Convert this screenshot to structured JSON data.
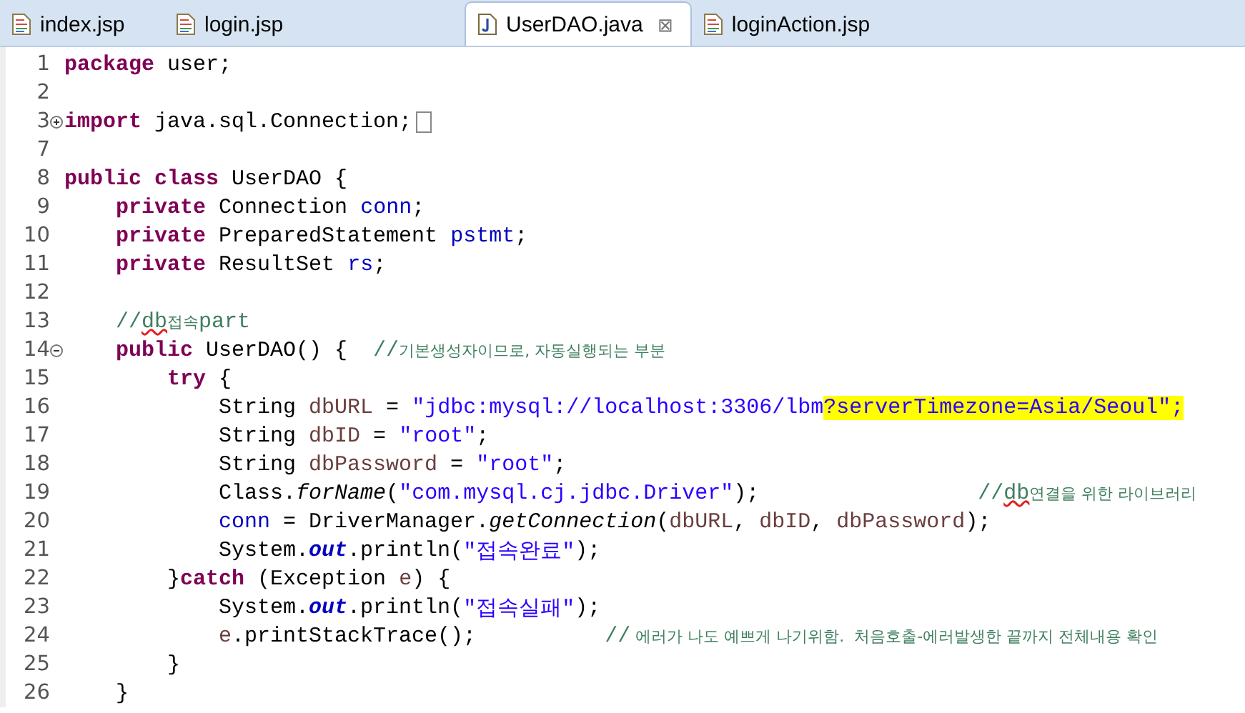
{
  "tabs": [
    {
      "label": "index.jsp",
      "kind": "jsp",
      "selected": false
    },
    {
      "label": "login.jsp",
      "kind": "jsp",
      "selected": false
    },
    {
      "label": "UserDAO.java",
      "kind": "java",
      "selected": true,
      "close": "⊠"
    },
    {
      "label": "loginAction.jsp",
      "kind": "jsp",
      "selected": false
    }
  ],
  "lines": [
    {
      "number": "1",
      "tokens": [
        {
          "kind": "keyword",
          "text": "package"
        },
        {
          "kind": "plain",
          "text": " user;"
        }
      ]
    },
    {
      "number": "2"
    },
    {
      "number": "3",
      "expanded": false,
      "tokens": [
        {
          "kind": "keyword",
          "text": "import"
        },
        {
          "kind": "plain",
          "text": " java.sql.Connection;"
        }
      ]
    },
    {
      "number": "7"
    },
    {
      "number": "8",
      "tokens": [
        {
          "kind": "keyword",
          "text": "public class"
        },
        {
          "kind": "plain",
          "text": " UserDAO {"
        }
      ]
    },
    {
      "number": "9",
      "tokens": [
        {
          "kind": "keyword",
          "text": "    private"
        },
        {
          "kind": "plain",
          "text": " Connection "
        },
        {
          "kind": "field",
          "text": "conn"
        },
        {
          "kind": "plain",
          "text": ";"
        }
      ]
    },
    {
      "number": "10",
      "tokens": [
        {
          "kind": "keyword",
          "text": "    private"
        },
        {
          "kind": "plain",
          "text": " PreparedStatement "
        },
        {
          "kind": "field",
          "text": "pstmt"
        },
        {
          "kind": "plain",
          "text": ";"
        }
      ]
    },
    {
      "number": "11",
      "tokens": [
        {
          "kind": "keyword",
          "text": "    private"
        },
        {
          "kind": "plain",
          "text": " ResultSet "
        },
        {
          "kind": "field",
          "text": "rs"
        },
        {
          "kind": "plain",
          "text": ";"
        }
      ]
    },
    {
      "number": "12"
    },
    {
      "number": "13",
      "tokens": [
        {
          "kind": "comment",
          "text": "    //"
        },
        {
          "kind": "misspelled",
          "text": "db"
        },
        {
          "kind": "note",
          "text": "접속"
        },
        {
          "kind": "comment",
          "text": "part"
        }
      ]
    },
    {
      "number": "14",
      "expanded": true,
      "tokens": [
        {
          "kind": "keyword",
          "text": "    public"
        },
        {
          "kind": "plain",
          "text": " UserDAO() {  "
        },
        {
          "kind": "comment",
          "text": "//"
        },
        {
          "kind": "note",
          "text": "기본생성자이므로, 자동실행되는 부분"
        }
      ]
    },
    {
      "number": "15",
      "tokens": [
        {
          "kind": "keyword",
          "text": "        try"
        },
        {
          "kind": "plain",
          "text": " {"
        }
      ]
    },
    {
      "number": "16",
      "tokens": [
        {
          "kind": "plain",
          "text": "            String "
        },
        {
          "kind": "local",
          "text": "dbURL"
        },
        {
          "kind": "plain",
          "text": " = "
        },
        {
          "kind": "string",
          "text": "\"jdbc:mysql://localhost:3306/lbm"
        },
        {
          "kind": "highlight",
          "text": "?serverTimezone=Asia/Seoul\";"
        }
      ]
    },
    {
      "number": "17",
      "tokens": [
        {
          "kind": "plain",
          "text": "            String "
        },
        {
          "kind": "local",
          "text": "dbID"
        },
        {
          "kind": "plain",
          "text": " = "
        },
        {
          "kind": "string",
          "text": "\"root\""
        },
        {
          "kind": "plain",
          "text": ";"
        }
      ]
    },
    {
      "number": "18",
      "tokens": [
        {
          "kind": "plain",
          "text": "            String "
        },
        {
          "kind": "local",
          "text": "dbPassword"
        },
        {
          "kind": "plain",
          "text": " = "
        },
        {
          "kind": "string",
          "text": "\"root\""
        },
        {
          "kind": "plain",
          "text": ";"
        }
      ]
    },
    {
      "number": "19",
      "tokens": [
        {
          "kind": "plain",
          "text": "            Class."
        },
        {
          "kind": "method",
          "text": "forName"
        },
        {
          "kind": "plain",
          "text": "("
        },
        {
          "kind": "string",
          "text": "\"com.mysql.cj.jdbc.Driver\""
        },
        {
          "kind": "plain",
          "text": ");                 "
        },
        {
          "kind": "comment",
          "text": "//"
        },
        {
          "kind": "misspelled",
          "text": "db"
        },
        {
          "kind": "note",
          "text": "연결을 위한 라이브러리"
        }
      ]
    },
    {
      "number": "20",
      "tokens": [
        {
          "kind": "field",
          "text": "            conn"
        },
        {
          "kind": "plain",
          "text": " = DriverManager."
        },
        {
          "kind": "method",
          "text": "getConnection"
        },
        {
          "kind": "plain",
          "text": "("
        },
        {
          "kind": "local",
          "text": "dbURL"
        },
        {
          "kind": "plain",
          "text": ", "
        },
        {
          "kind": "local",
          "text": "dbID"
        },
        {
          "kind": "plain",
          "text": ", "
        },
        {
          "kind": "local",
          "text": "dbPassword"
        },
        {
          "kind": "plain",
          "text": ");"
        }
      ]
    },
    {
      "number": "21",
      "tokens": [
        {
          "kind": "plain",
          "text": "            System."
        },
        {
          "kind": "static",
          "text": "out"
        },
        {
          "kind": "plain",
          "text": ".println("
        },
        {
          "kind": "string",
          "text": "\"접속완료\""
        },
        {
          "kind": "plain",
          "text": ");"
        }
      ]
    },
    {
      "number": "22",
      "tokens": [
        {
          "kind": "plain",
          "text": "        }"
        },
        {
          "kind": "keyword",
          "text": "catch"
        },
        {
          "kind": "plain",
          "text": " (Exception "
        },
        {
          "kind": "local",
          "text": "e"
        },
        {
          "kind": "plain",
          "text": ") {"
        }
      ]
    },
    {
      "number": "23",
      "tokens": [
        {
          "kind": "plain",
          "text": "            System."
        },
        {
          "kind": "static",
          "text": "out"
        },
        {
          "kind": "plain",
          "text": ".println("
        },
        {
          "kind": "string",
          "text": "\"접속실패\""
        },
        {
          "kind": "plain",
          "text": ");"
        }
      ]
    },
    {
      "number": "24",
      "tokens": [
        {
          "kind": "local",
          "text": "            e"
        },
        {
          "kind": "plain",
          "text": ".printStackTrace();          "
        },
        {
          "kind": "comment",
          "text": "//"
        },
        {
          "kind": "note",
          "text": " 에러가 나도 예쁘게 나기위함.  처음호출-에러발생한 끝까지 전체내용 확인"
        }
      ]
    },
    {
      "number": "25",
      "tokens": [
        {
          "kind": "plain",
          "text": "        }"
        }
      ]
    },
    {
      "number": "26",
      "tokens": [
        {
          "kind": "plain",
          "text": "    }"
        }
      ]
    }
  ]
}
